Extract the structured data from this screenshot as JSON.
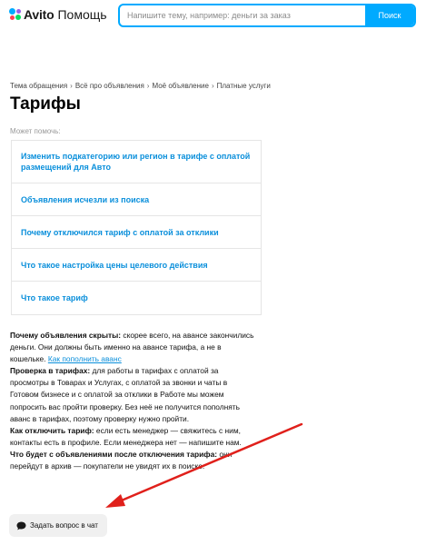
{
  "header": {
    "logo_brand": "Avito",
    "logo_section": "Помощь",
    "search_placeholder": "Напишите тему, например: деньги за заказ",
    "search_button": "Поиск"
  },
  "breadcrumb": [
    "Тема обращения",
    "Всё про объявления",
    "Моё объявление",
    "Платные услуги"
  ],
  "breadcrumb_separator": "›",
  "page_title": "Тарифы",
  "suggestions_label": "Может помочь:",
  "suggestions": [
    {
      "label": "Изменить подкатегорию или регион в тарифе с оплатой размещений для Авто"
    },
    {
      "label": "Объявления исчезли из поиска"
    },
    {
      "label": "Почему отключился тариф с оплатой за отклики"
    },
    {
      "label": "Что такое настройка цены целевого действия"
    },
    {
      "label": "Что такое тариф"
    }
  ],
  "article": {
    "q1": "Почему объявления скрыты:",
    "a1": " скорее всего, на авансе закончились деньги. Они должны быть именно на авансе тарифа, а не в кошельке. ",
    "a1_link": "Как пополнить аванс",
    "q2": "Проверка в тарифах:",
    "a2": " для работы в тарифах с оплатой за просмотры в Товарах и Услугах, с оплатой за звонки и чаты в Готовом бизнесе и с оплатой за отклики в Работе мы можем попросить вас пройти проверку. Без неё не получится пополнять аванс в тарифах, поэтому проверку нужно пройти.",
    "q3": "Как отключить тариф:",
    "a3": " если есть менеджер — свяжитесь с ним, контакты есть в профиле. Если менеджера нет — напишите нам.",
    "q4": "Что будет с объявлениями после отключения тарифа:",
    "a4": " они перейдут в архив — покупатели не увидят их в поиске."
  },
  "chat_button": {
    "label": "Задать вопрос в чат",
    "icon": "chat-bubble-icon"
  },
  "colors": {
    "accent": "#00aaff",
    "link": "#0a8fdb",
    "annotation_arrow": "#e0201b"
  }
}
